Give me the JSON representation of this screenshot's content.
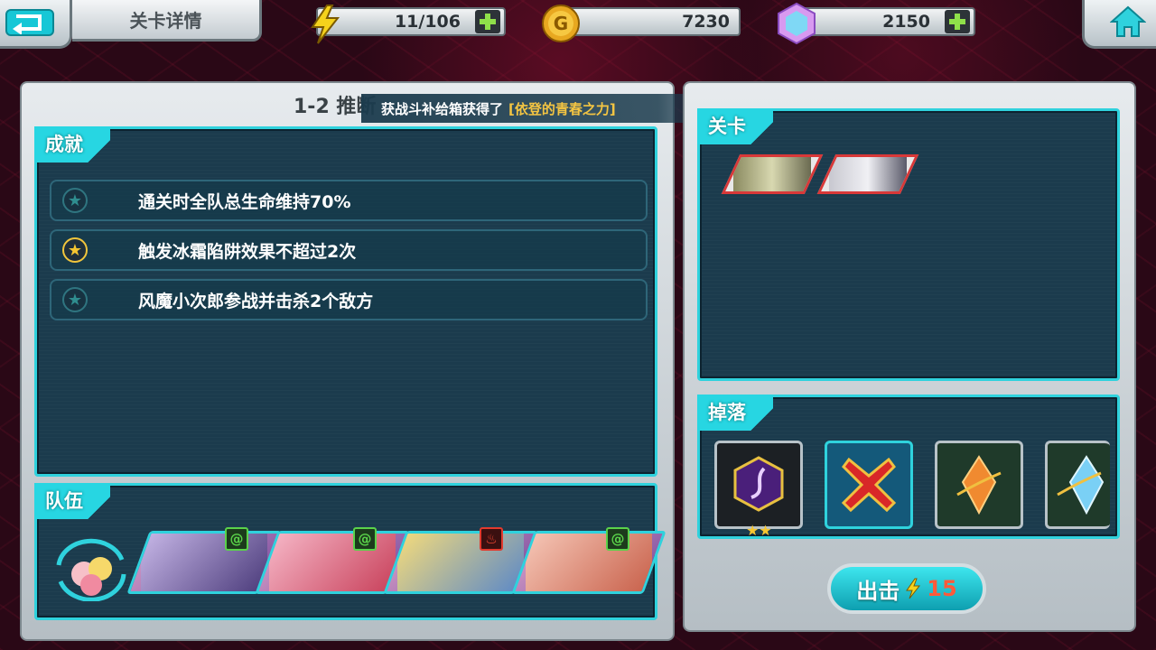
{
  "header": {
    "title": "关卡详情",
    "energy": "11/106",
    "gold": "7230",
    "gems": "2150"
  },
  "stage": {
    "title": "1-2  推断",
    "notice_prefix": "获战斗补给箱获得了",
    "notice_item": "[依登的青春之力]"
  },
  "achievements": {
    "tab_label": "成就",
    "items": [
      {
        "text": "通关时全队总生命维持70%",
        "achieved": false
      },
      {
        "text": "触发冰霜陷阱效果不超过2次",
        "achieved": true
      },
      {
        "text": "风魔小次郎参战并击杀2个敌方",
        "achieved": false
      }
    ]
  },
  "team": {
    "tab_label": "队伍",
    "members": [
      {
        "element": "wind"
      },
      {
        "element": "wind"
      },
      {
        "element": "fire"
      },
      {
        "element": "wind"
      }
    ]
  },
  "enemies": {
    "tab_label": "关卡",
    "count": 2
  },
  "drops": {
    "tab_label": "掉落",
    "items": [
      {
        "name": "purple-rune",
        "stars": 2
      },
      {
        "name": "red-x",
        "stars": 0
      },
      {
        "name": "orange-crystal",
        "stars": 0
      },
      {
        "name": "blue-crystal",
        "stars": 0
      }
    ]
  },
  "sortie": {
    "label": "出击",
    "cost": "15"
  }
}
